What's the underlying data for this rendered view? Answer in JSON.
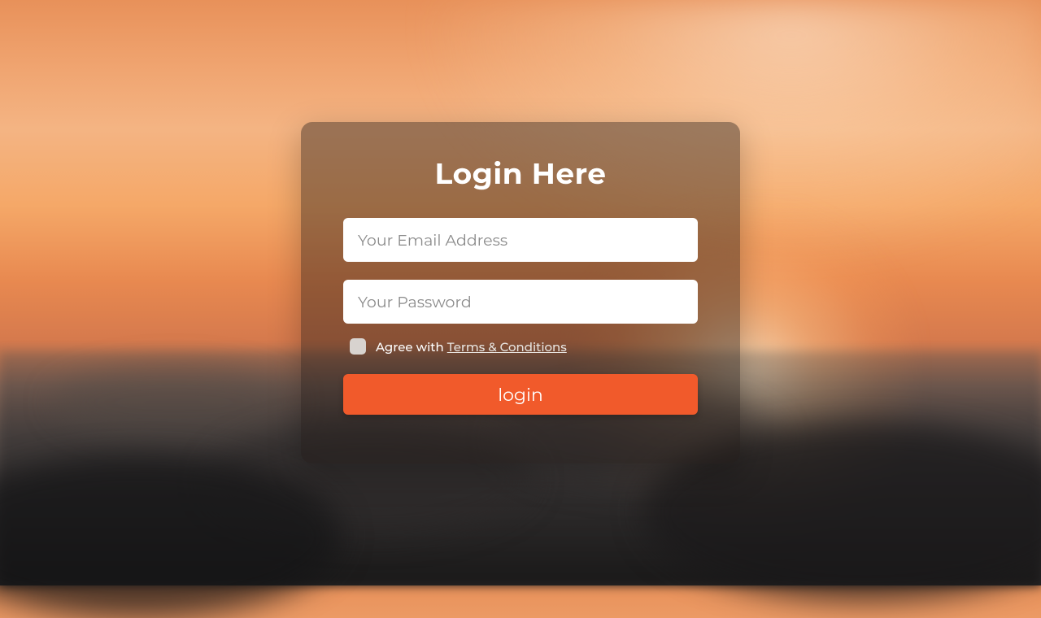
{
  "form": {
    "title": "Login Here",
    "email": {
      "placeholder": "Your Email Address",
      "value": ""
    },
    "password": {
      "placeholder": "Your Password",
      "value": ""
    },
    "agree": {
      "label_prefix": "Agree with ",
      "terms_link_text": "Terms & Conditions",
      "checked": false
    },
    "submit_label": "login"
  },
  "colors": {
    "accent": "#f15a2b",
    "card_bg": "rgba(30,25,22,0.42)"
  }
}
